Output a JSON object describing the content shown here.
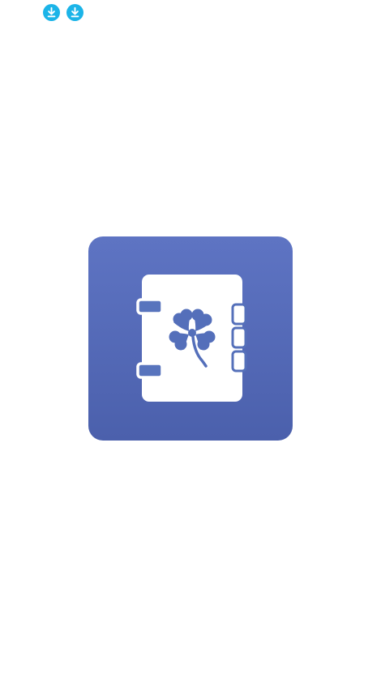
{
  "status_bar": {
    "notifications": [
      {
        "icon": "download-icon",
        "color": "#1BB4E8"
      },
      {
        "icon": "download-icon",
        "color": "#1BB4E8"
      }
    ]
  },
  "splash": {
    "logo_icon": "notebook-clover-icon",
    "colors": {
      "background_top": "#5E74C3",
      "background_bottom": "#4B60AC",
      "foreground": "#FFFFFF"
    }
  }
}
